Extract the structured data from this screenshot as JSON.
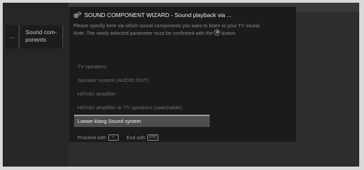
{
  "left_panel": {
    "back_label": "...",
    "sound_components": "Sound com-\nponents"
  },
  "dialog": {
    "title": "SOUND COMPONENT WIZARD - Sound playback via ...",
    "instructions": "Please specify here via which sound components you want to listen to your TV sound.",
    "note_prefix": "Note: The newly selected parameter must be confirmed with the",
    "note_suffix": "button.",
    "options": [
      {
        "label": "TV speakers",
        "selected": false
      },
      {
        "label": "Speaker system (AUDIO OUT)",
        "selected": false
      },
      {
        "label": "HiFi/AV amplifier",
        "selected": false
      },
      {
        "label": "HiFi/AV amplifier or TV speakers (switchable)",
        "selected": false
      },
      {
        "label": "Loewe klang Sound system",
        "selected": true
      }
    ],
    "footer": {
      "proceed": "Proceed with",
      "proceed_key": "↵",
      "end": "End with",
      "end_key": "END"
    }
  },
  "colors": {
    "screen_bg": "#2e2d2e",
    "dialog_bg": "#1c1b1c",
    "selected_bg": "#4f4e4f"
  }
}
